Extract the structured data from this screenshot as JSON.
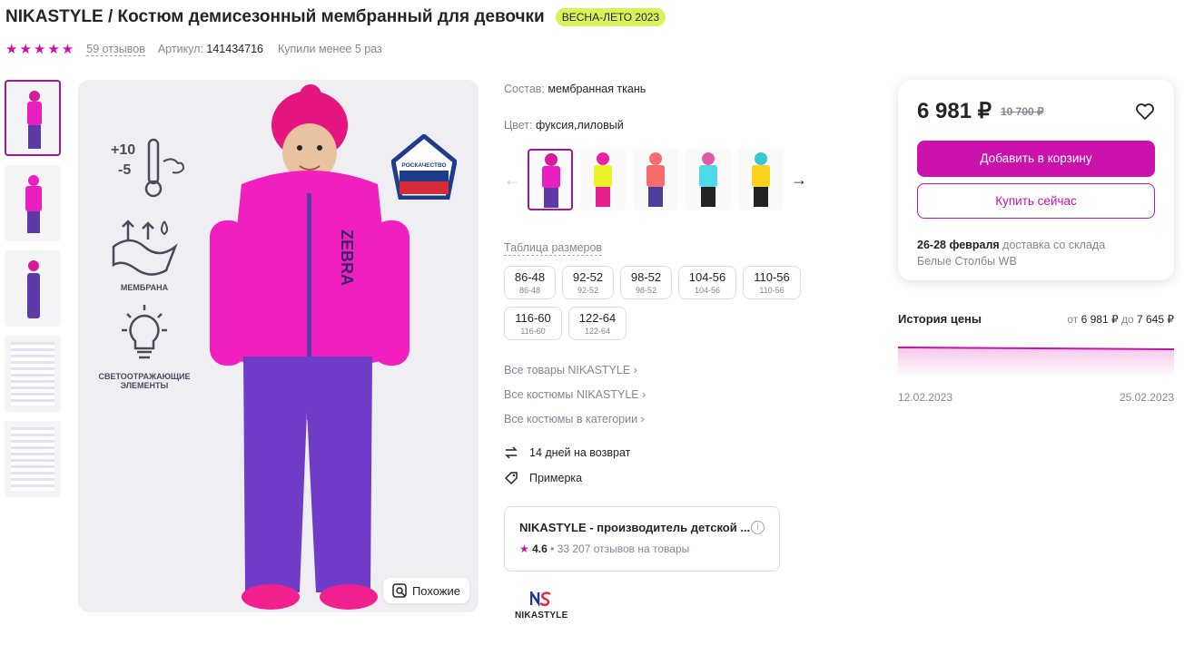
{
  "header": {
    "title": "NIKASTYLE / Костюм демисезонный мембранный для девочки",
    "badge": "ВЕСНА-ЛЕТО 2023"
  },
  "meta": {
    "stars": "★★★★★",
    "reviews": "59 отзывов",
    "article_label": "Артикул:",
    "article_value": "141434716",
    "bought": "Купили менее 5 раз"
  },
  "photo": {
    "features": [
      {
        "icon": "thermometer-icon",
        "text_top": "+10",
        "text_bottom": "-5"
      },
      {
        "icon": "membrane-icon",
        "label": "МЕМБРАНА"
      },
      {
        "icon": "lightbulb-icon",
        "label": "СВЕТООТРАЖАЮЩИЕ ЭЛЕМЕНТЫ"
      }
    ],
    "roskachestvo": "РОСКАЧЕСТВО",
    "jacket_print": "ZEBRA",
    "similar_label": "Похожие"
  },
  "details": {
    "composition_label": "Состав:",
    "composition_value": "мембранная ткань",
    "color_label": "Цвет:",
    "color_value": "фуксия,лиловый",
    "color_variants": [
      {
        "jacket": "#e91ec1",
        "pants": "#5c3aa8",
        "hat": "#d81b9a"
      },
      {
        "jacket": "#eef22a",
        "pants": "#e71e8f",
        "hat": "#f01ea5"
      },
      {
        "jacket": "#f76d6d",
        "pants": "#4d3e9e",
        "hat": "#f76d6d"
      },
      {
        "jacket": "#4fd8e8",
        "pants": "#222222",
        "hat": "#e05aa8"
      },
      {
        "jacket": "#ffd21f",
        "pants": "#222222",
        "hat": "#38c7d0"
      }
    ],
    "sizes_title": "Таблица размеров",
    "sizes": [
      {
        "main": "86-48",
        "sub": "86-48"
      },
      {
        "main": "92-52",
        "sub": "92-52"
      },
      {
        "main": "98-52",
        "sub": "98-52"
      },
      {
        "main": "104-56",
        "sub": "104-56"
      },
      {
        "main": "110-56",
        "sub": "110-56"
      },
      {
        "main": "116-60",
        "sub": "116-60"
      },
      {
        "main": "122-64",
        "sub": "122-64"
      }
    ],
    "links": [
      "Все товары NIKASTYLE ›",
      "Все костюмы NIKASTYLE ›",
      "Все костюмы в категории ›"
    ],
    "return_label": "14 дней на возврат",
    "fitting_label": "Примерка",
    "seller": {
      "name": "NIKASTYLE - производитель детской ...",
      "rating": "4.6",
      "reviews": "33 207 отзывов на товары"
    },
    "brand_name": "NIKASTYLE"
  },
  "buy": {
    "price": "6 981 ₽",
    "old_price": "10 700 ₽",
    "add_to_cart": "Добавить в корзину",
    "buy_now": "Купить сейчас",
    "delivery_dates": "26-28 февраля",
    "delivery_text": "доставка со склада",
    "warehouse": "Белые Столбы WB"
  },
  "history": {
    "title": "История цены",
    "range_from_label": "от",
    "range_from": "6 981 ₽",
    "range_to_label": "до",
    "range_to": "7 645 ₽",
    "date_start": "12.02.2023",
    "date_end": "25.02.2023"
  },
  "colors": {
    "accent": "#cb11ab",
    "accent_dark": "#9c1b91",
    "badge": "#d8f35a"
  }
}
